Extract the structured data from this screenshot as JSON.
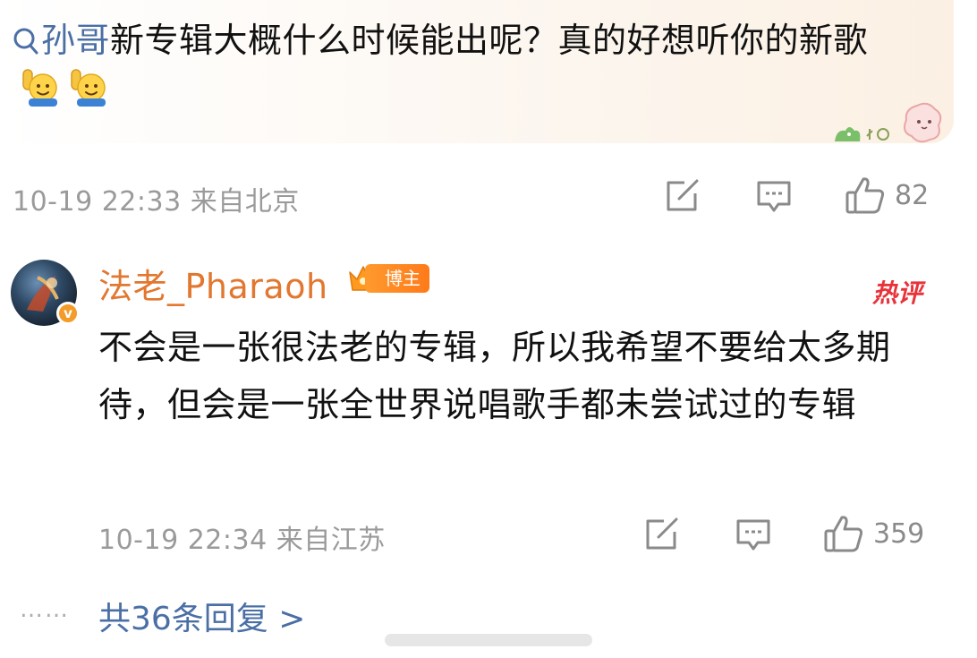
{
  "post": {
    "mention": "孙哥",
    "text": "新专辑大概什么时候能出呢？真的好想听你的新歌",
    "emojis": [
      "raising-hand-emoji",
      "raising-hand-emoji"
    ]
  },
  "post_meta": {
    "timestamp": "10-19 22:33",
    "location": "来自北京",
    "like_count": "82"
  },
  "reply": {
    "username": "法老_Pharaoh",
    "badge_label": "博主",
    "hot_tag": "热评",
    "text": "不会是一张很法老的专辑，所以我希望不要给太多期待，但会是一张全世界说唱歌手都未尝试过的专辑",
    "timestamp": "10-19 22:34",
    "location": "来自江苏",
    "like_count": "359"
  },
  "footer": {
    "dots": "……",
    "more_replies": "共36条回复 >"
  },
  "colors": {
    "mention": "#4a6fa5",
    "username": "#e2772f",
    "hot_tag": "#e8333b",
    "meta_gray": "#9a9a9a"
  }
}
